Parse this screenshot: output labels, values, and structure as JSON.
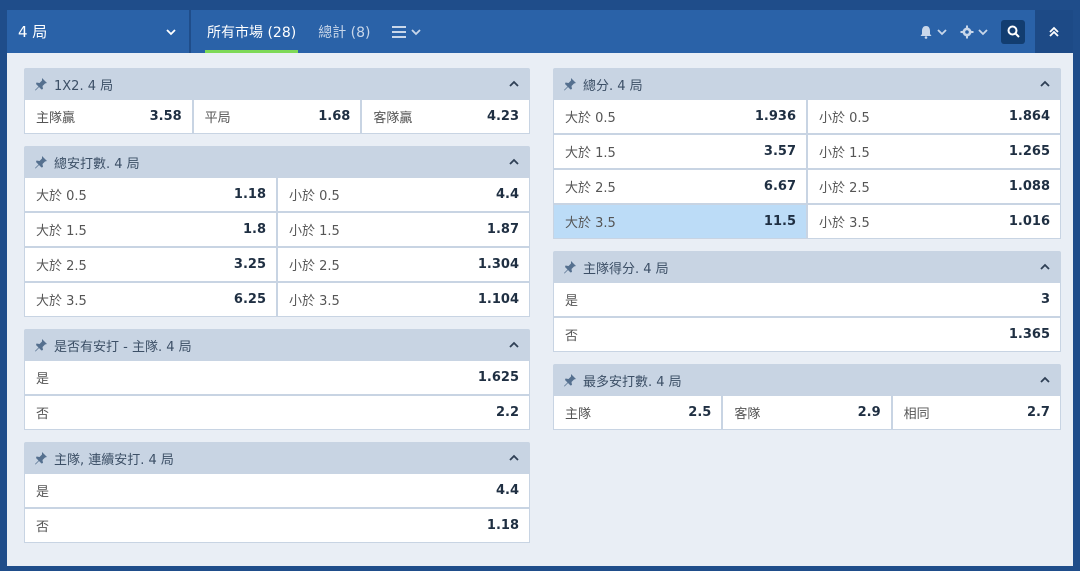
{
  "header": {
    "period_label": "4 局",
    "tabs": [
      {
        "label": "所有市場 (28)",
        "active": true
      },
      {
        "label": "總計 (8)",
        "active": false
      }
    ]
  },
  "colors": {
    "accent": "#7ed957",
    "selected": "#bcdcf7",
    "header_bg": "#2a62a8"
  },
  "left": [
    {
      "title": "1X2. 4 局",
      "rows": [
        [
          {
            "label": "主隊贏",
            "odds": "3.58"
          },
          {
            "label": "平局",
            "odds": "1.68"
          },
          {
            "label": "客隊贏",
            "odds": "4.23"
          }
        ]
      ]
    },
    {
      "title": "總安打數. 4 局",
      "rows": [
        [
          {
            "label": "大於 0.5",
            "odds": "1.18"
          },
          {
            "label": "小於 0.5",
            "odds": "4.4"
          }
        ],
        [
          {
            "label": "大於 1.5",
            "odds": "1.8"
          },
          {
            "label": "小於 1.5",
            "odds": "1.87"
          }
        ],
        [
          {
            "label": "大於 2.5",
            "odds": "3.25"
          },
          {
            "label": "小於 2.5",
            "odds": "1.304"
          }
        ],
        [
          {
            "label": "大於 3.5",
            "odds": "6.25"
          },
          {
            "label": "小於 3.5",
            "odds": "1.104"
          }
        ]
      ]
    },
    {
      "title": "是否有安打 - 主隊. 4 局",
      "rows": [
        [
          {
            "label": "是",
            "odds": "1.625"
          }
        ],
        [
          {
            "label": "否",
            "odds": "2.2"
          }
        ]
      ]
    },
    {
      "title": "主隊, 連續安打. 4 局",
      "rows": [
        [
          {
            "label": "是",
            "odds": "4.4"
          }
        ],
        [
          {
            "label": "否",
            "odds": "1.18"
          }
        ]
      ]
    }
  ],
  "right": [
    {
      "title": "總分. 4 局",
      "rows": [
        [
          {
            "label": "大於 0.5",
            "odds": "1.936"
          },
          {
            "label": "小於 0.5",
            "odds": "1.864"
          }
        ],
        [
          {
            "label": "大於 1.5",
            "odds": "3.57"
          },
          {
            "label": "小於 1.5",
            "odds": "1.265"
          }
        ],
        [
          {
            "label": "大於 2.5",
            "odds": "6.67"
          },
          {
            "label": "小於 2.5",
            "odds": "1.088"
          }
        ],
        [
          {
            "label": "大於 3.5",
            "odds": "11.5",
            "selected": true
          },
          {
            "label": "小於 3.5",
            "odds": "1.016"
          }
        ]
      ]
    },
    {
      "title": "主隊得分. 4 局",
      "rows": [
        [
          {
            "label": "是",
            "odds": "3"
          }
        ],
        [
          {
            "label": "否",
            "odds": "1.365"
          }
        ]
      ]
    },
    {
      "title": "最多安打數. 4 局",
      "rows": [
        [
          {
            "label": "主隊",
            "odds": "2.5"
          },
          {
            "label": "客隊",
            "odds": "2.9"
          },
          {
            "label": "相同",
            "odds": "2.7"
          }
        ]
      ]
    }
  ]
}
